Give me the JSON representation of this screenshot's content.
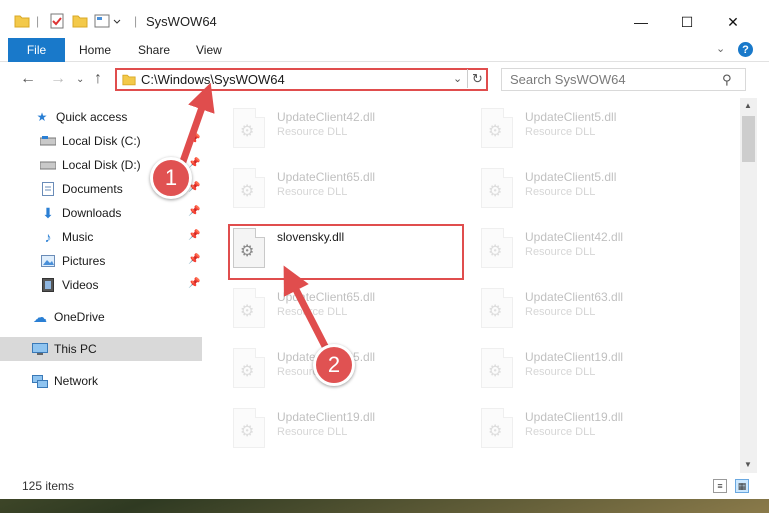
{
  "window": {
    "title": "SysWOW64",
    "controls": {
      "minimize": "—",
      "maximize": "☐",
      "close": "✕"
    }
  },
  "ribbon": {
    "file": "File",
    "tabs": [
      "Home",
      "Share",
      "View"
    ],
    "help": "?"
  },
  "address_bar": {
    "path": "C:\\Windows\\SysWOW64",
    "search_placeholder": "Search SysWOW64"
  },
  "sidebar": {
    "quick_access": "Quick access",
    "items": [
      {
        "label": "Local Disk (C:)",
        "icon": "drive-icon"
      },
      {
        "label": "Local Disk (D:)",
        "icon": "drive-icon"
      },
      {
        "label": "Documents",
        "icon": "documents-icon"
      },
      {
        "label": "Downloads",
        "icon": "downloads-icon"
      },
      {
        "label": "Music",
        "icon": "music-icon"
      },
      {
        "label": "Pictures",
        "icon": "pictures-icon"
      },
      {
        "label": "Videos",
        "icon": "videos-icon"
      }
    ],
    "onedrive": "OneDrive",
    "this_pc": "This PC",
    "network": "Network"
  },
  "files": {
    "left_column": [
      {
        "name": "UpdateClient42.dll",
        "type": "Resource DLL"
      },
      {
        "name": "UpdateClient65.dll",
        "type": "Resource DLL"
      },
      {
        "name": "slovensky.dll",
        "type": ""
      },
      {
        "name": "UpdateClient65.dll",
        "type": "Resource DLL"
      },
      {
        "name": "UpdateClient65.dll",
        "type": "Resource DLL"
      },
      {
        "name": "UpdateClient19.dll",
        "type": "Resource DLL"
      }
    ],
    "right_column": [
      {
        "name": "UpdateClient5.dll",
        "type": "Resource DLL"
      },
      {
        "name": "UpdateClient5.dll",
        "type": "Resource DLL"
      },
      {
        "name": "UpdateClient42.dll",
        "type": "Resource DLL"
      },
      {
        "name": "UpdateClient63.dll",
        "type": "Resource DLL"
      },
      {
        "name": "UpdateClient19.dll",
        "type": "Resource DLL"
      },
      {
        "name": "UpdateClient19.dll",
        "type": "Resource DLL"
      }
    ]
  },
  "status": {
    "item_count": "125 items"
  },
  "annotations": {
    "step1": "1",
    "step2": "2",
    "color": "#e04d4d"
  }
}
